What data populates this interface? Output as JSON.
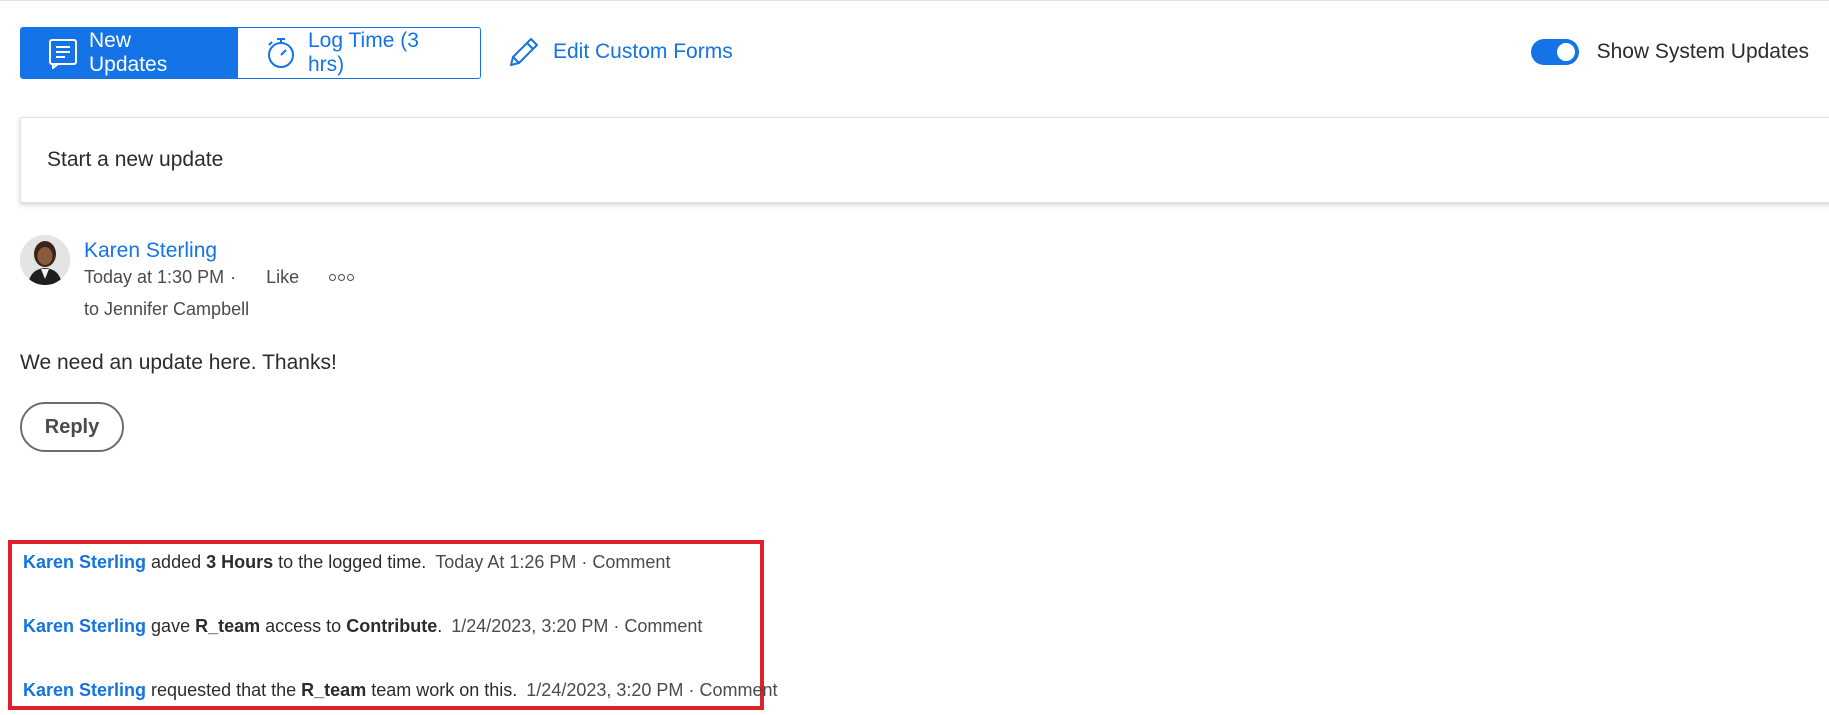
{
  "toolbar": {
    "tabs": [
      {
        "label": "New Updates",
        "icon": "notes-icon",
        "active": true
      },
      {
        "label": "Log Time (3 hrs)",
        "icon": "stopwatch-icon",
        "active": false
      }
    ],
    "edit_forms_label": "Edit Custom Forms",
    "system_updates_label": "Show System Updates",
    "system_updates_on": true
  },
  "composer": {
    "placeholder": "Start a new update"
  },
  "post": {
    "author": "Karen Sterling",
    "time": "Today at 1:30 PM",
    "separator": "·",
    "like_label": "Like",
    "recipient": "to Jennifer Campbell",
    "message": "We need an update here. Thanks!",
    "reply_label": "Reply"
  },
  "system_updates": [
    {
      "who": "Karen Sterling",
      "parts": [
        "added",
        "3 Hours",
        "to the logged time."
      ],
      "time": "Today At 1:26 PM",
      "sep": "·",
      "comment": "Comment"
    },
    {
      "who": "Karen Sterling",
      "parts": [
        "gave",
        "R_team",
        "access to",
        "Contribute",
        "."
      ],
      "time": "1/24/2023, 3:20 PM",
      "sep": "·",
      "comment": "Comment"
    },
    {
      "who": "Karen Sterling",
      "parts": [
        "requested that the",
        "R_team",
        "team work on this."
      ],
      "time": "1/24/2023, 3:20 PM",
      "sep": "·",
      "comment": "Comment"
    }
  ],
  "colors": {
    "accent": "#1473e6",
    "highlight_border": "#e0202a"
  }
}
